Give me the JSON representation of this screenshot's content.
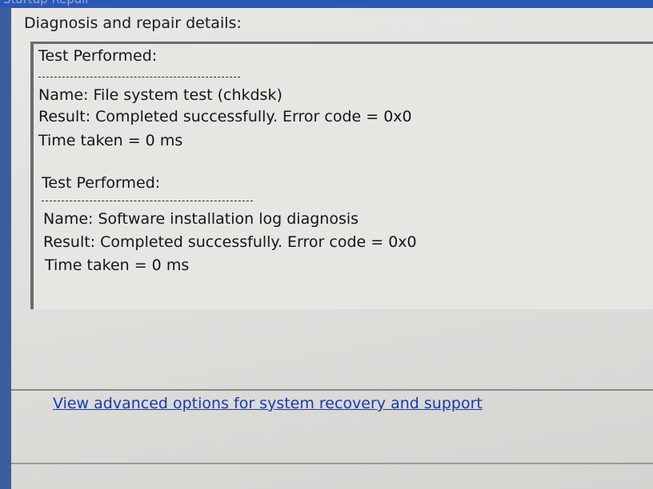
{
  "window": {
    "title": "Startup Repair",
    "section_heading": "Diagnosis and repair details:"
  },
  "tests": [
    {
      "header": "Test Performed:",
      "rule": "-------------------------------",
      "name": "Name: File system test (chkdsk)",
      "result": "Result: Completed successfully. Error code =  0x0",
      "time": "Time taken = 0 ms"
    },
    {
      "header": "Test Performed:",
      "rule": "-------------------------------",
      "name": "Name: Software installation log diagnosis",
      "result": "Result: Completed successfully. Error code =  0x0",
      "time": "Time taken = 0 ms"
    }
  ],
  "footer": {
    "advanced_link": "View advanced options for system recovery and support"
  },
  "colors": {
    "link": "#1c3aa8",
    "title_bar": "#2b58b8",
    "panel": "#e4e4e1"
  }
}
